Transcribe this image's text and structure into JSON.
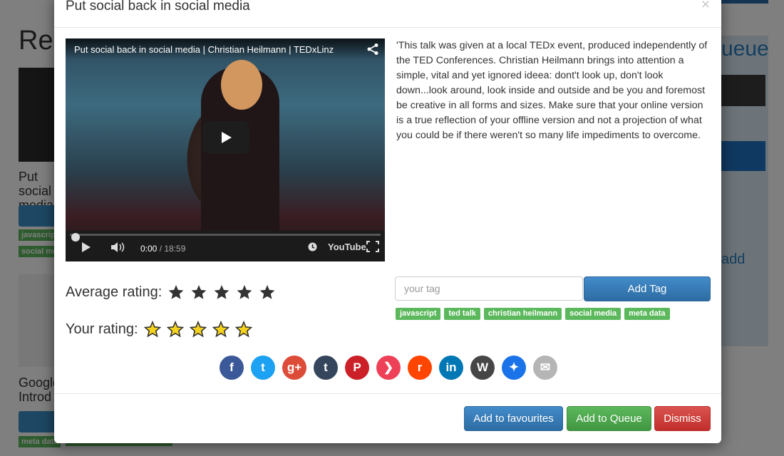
{
  "background": {
    "heading": "Rec",
    "card1_title": "Put social media",
    "card1_tags": [
      "javascript",
      "social me"
    ],
    "card2_title": "Google Introd",
    "card2_tags": [
      "meta data"
    ],
    "queue_panel_title": "ueue",
    "queue_add": "add"
  },
  "modal": {
    "title": "Put social back in social media",
    "close": "×",
    "video": {
      "title": "Put social back in social media | Christian Heilmann | TEDxLinz",
      "time_current": "0:00",
      "time_duration": " / 18:59",
      "progress_fraction": 0.0,
      "youtube_label": "YouTube"
    },
    "description": "'This talk was given at a local TEDx event, produced independently of the TED Conferences. Christian Heilmann brings into attention a simple, vital and yet ignored ideea: dont't look up, don't look down...look around, look inside and outside and be you and foremost be creative in all forms and sizes. Make sure that your online version is a true reflection of your offline version and not a projection of what you could be if there weren't so many life impediments to overcome.",
    "average_rating_label": "Average rating:",
    "average_rating_value": 5,
    "your_rating_label": "Your rating:",
    "your_rating_value": 0,
    "tag_input_placeholder": "your tag",
    "add_tag_label": "Add Tag",
    "tags": [
      "javascript",
      "ted talk",
      "christian heilmann",
      "social media",
      "meta data"
    ],
    "social": [
      {
        "name": "facebook",
        "glyph": "f",
        "color": "#3b5998"
      },
      {
        "name": "twitter",
        "glyph": "t",
        "color": "#1da1f2"
      },
      {
        "name": "google-plus",
        "glyph": "g+",
        "color": "#dd4b39"
      },
      {
        "name": "tumblr",
        "glyph": "t",
        "color": "#35465c"
      },
      {
        "name": "pinterest",
        "glyph": "P",
        "color": "#cb2027"
      },
      {
        "name": "pocket",
        "glyph": "❯",
        "color": "#ee4056"
      },
      {
        "name": "reddit",
        "glyph": "r",
        "color": "#ff4500"
      },
      {
        "name": "linkedin",
        "glyph": "in",
        "color": "#0077b5"
      },
      {
        "name": "wordpress",
        "glyph": "W",
        "color": "#464646"
      },
      {
        "name": "pinboard",
        "glyph": "✦",
        "color": "#1a73e8"
      },
      {
        "name": "email",
        "glyph": "✉",
        "color": "#b5b5b5"
      }
    ],
    "buttons": {
      "favourites": "Add to favourites",
      "queue": "Add to Queue",
      "dismiss": "Dismiss"
    },
    "colors": {
      "primary": "#428bca",
      "success": "#5cb85c",
      "danger": "#d9534f",
      "star_filled": "#333333",
      "star_outline_fill": "#f4d21e"
    }
  }
}
